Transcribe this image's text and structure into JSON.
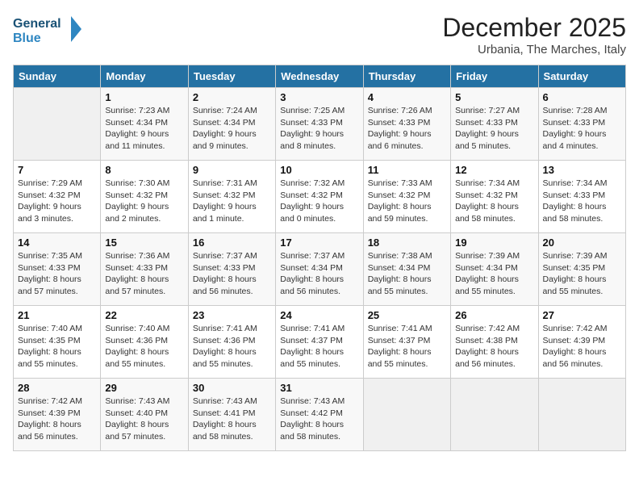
{
  "header": {
    "logo_text_general": "General",
    "logo_text_blue": "Blue",
    "month_title": "December 2025",
    "subtitle": "Urbania, The Marches, Italy"
  },
  "weekdays": [
    "Sunday",
    "Monday",
    "Tuesday",
    "Wednesday",
    "Thursday",
    "Friday",
    "Saturday"
  ],
  "weeks": [
    [
      {
        "day": "",
        "empty": true
      },
      {
        "day": "1",
        "sunrise": "7:23 AM",
        "sunset": "4:34 PM",
        "daylight": "9 hours and 11 minutes."
      },
      {
        "day": "2",
        "sunrise": "7:24 AM",
        "sunset": "4:34 PM",
        "daylight": "9 hours and 9 minutes."
      },
      {
        "day": "3",
        "sunrise": "7:25 AM",
        "sunset": "4:33 PM",
        "daylight": "9 hours and 8 minutes."
      },
      {
        "day": "4",
        "sunrise": "7:26 AM",
        "sunset": "4:33 PM",
        "daylight": "9 hours and 6 minutes."
      },
      {
        "day": "5",
        "sunrise": "7:27 AM",
        "sunset": "4:33 PM",
        "daylight": "9 hours and 5 minutes."
      },
      {
        "day": "6",
        "sunrise": "7:28 AM",
        "sunset": "4:33 PM",
        "daylight": "9 hours and 4 minutes."
      }
    ],
    [
      {
        "day": "7",
        "sunrise": "7:29 AM",
        "sunset": "4:32 PM",
        "daylight": "9 hours and 3 minutes."
      },
      {
        "day": "8",
        "sunrise": "7:30 AM",
        "sunset": "4:32 PM",
        "daylight": "9 hours and 2 minutes."
      },
      {
        "day": "9",
        "sunrise": "7:31 AM",
        "sunset": "4:32 PM",
        "daylight": "9 hours and 1 minute."
      },
      {
        "day": "10",
        "sunrise": "7:32 AM",
        "sunset": "4:32 PM",
        "daylight": "9 hours and 0 minutes."
      },
      {
        "day": "11",
        "sunrise": "7:33 AM",
        "sunset": "4:32 PM",
        "daylight": "8 hours and 59 minutes."
      },
      {
        "day": "12",
        "sunrise": "7:34 AM",
        "sunset": "4:32 PM",
        "daylight": "8 hours and 58 minutes."
      },
      {
        "day": "13",
        "sunrise": "7:34 AM",
        "sunset": "4:33 PM",
        "daylight": "8 hours and 58 minutes."
      }
    ],
    [
      {
        "day": "14",
        "sunrise": "7:35 AM",
        "sunset": "4:33 PM",
        "daylight": "8 hours and 57 minutes."
      },
      {
        "day": "15",
        "sunrise": "7:36 AM",
        "sunset": "4:33 PM",
        "daylight": "8 hours and 57 minutes."
      },
      {
        "day": "16",
        "sunrise": "7:37 AM",
        "sunset": "4:33 PM",
        "daylight": "8 hours and 56 minutes."
      },
      {
        "day": "17",
        "sunrise": "7:37 AM",
        "sunset": "4:34 PM",
        "daylight": "8 hours and 56 minutes."
      },
      {
        "day": "18",
        "sunrise": "7:38 AM",
        "sunset": "4:34 PM",
        "daylight": "8 hours and 55 minutes."
      },
      {
        "day": "19",
        "sunrise": "7:39 AM",
        "sunset": "4:34 PM",
        "daylight": "8 hours and 55 minutes."
      },
      {
        "day": "20",
        "sunrise": "7:39 AM",
        "sunset": "4:35 PM",
        "daylight": "8 hours and 55 minutes."
      }
    ],
    [
      {
        "day": "21",
        "sunrise": "7:40 AM",
        "sunset": "4:35 PM",
        "daylight": "8 hours and 55 minutes."
      },
      {
        "day": "22",
        "sunrise": "7:40 AM",
        "sunset": "4:36 PM",
        "daylight": "8 hours and 55 minutes."
      },
      {
        "day": "23",
        "sunrise": "7:41 AM",
        "sunset": "4:36 PM",
        "daylight": "8 hours and 55 minutes."
      },
      {
        "day": "24",
        "sunrise": "7:41 AM",
        "sunset": "4:37 PM",
        "daylight": "8 hours and 55 minutes."
      },
      {
        "day": "25",
        "sunrise": "7:41 AM",
        "sunset": "4:37 PM",
        "daylight": "8 hours and 55 minutes."
      },
      {
        "day": "26",
        "sunrise": "7:42 AM",
        "sunset": "4:38 PM",
        "daylight": "8 hours and 56 minutes."
      },
      {
        "day": "27",
        "sunrise": "7:42 AM",
        "sunset": "4:39 PM",
        "daylight": "8 hours and 56 minutes."
      }
    ],
    [
      {
        "day": "28",
        "sunrise": "7:42 AM",
        "sunset": "4:39 PM",
        "daylight": "8 hours and 56 minutes."
      },
      {
        "day": "29",
        "sunrise": "7:43 AM",
        "sunset": "4:40 PM",
        "daylight": "8 hours and 57 minutes."
      },
      {
        "day": "30",
        "sunrise": "7:43 AM",
        "sunset": "4:41 PM",
        "daylight": "8 hours and 58 minutes."
      },
      {
        "day": "31",
        "sunrise": "7:43 AM",
        "sunset": "4:42 PM",
        "daylight": "8 hours and 58 minutes."
      },
      {
        "day": "",
        "empty": true
      },
      {
        "day": "",
        "empty": true
      },
      {
        "day": "",
        "empty": true
      }
    ]
  ]
}
